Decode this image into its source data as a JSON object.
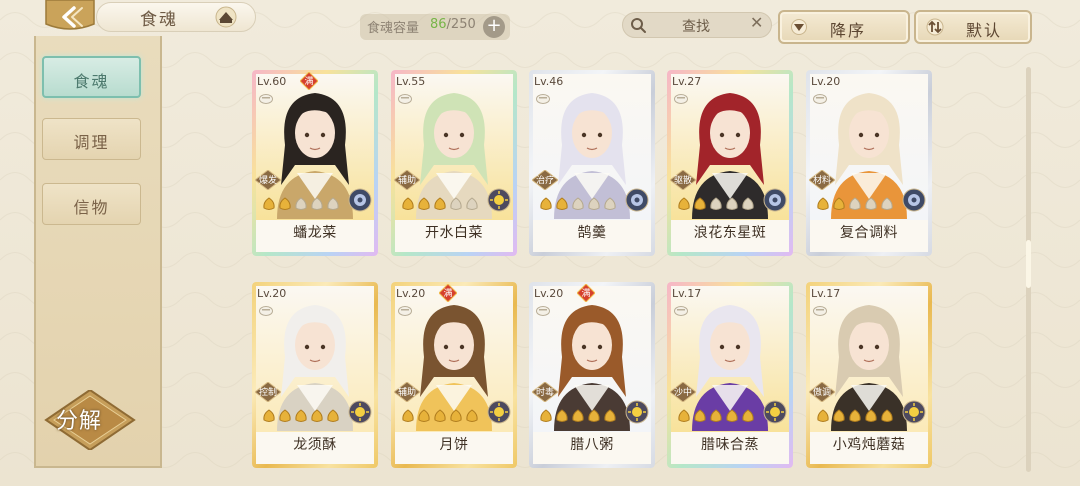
{
  "header": {
    "title": "食魂",
    "capacity_label": "食魂容量",
    "capacity_current": "86",
    "capacity_total": "/250",
    "capacity_add": "+",
    "search_label": "查找",
    "search_clear": "✕",
    "sort_desc_label": "降序",
    "sort_default_label": "默认"
  },
  "sidebar": {
    "tabs": [
      {
        "label": "食魂",
        "active": true
      },
      {
        "label": "调理",
        "active": false
      },
      {
        "label": "信物",
        "active": false
      }
    ],
    "decompose_label": "分解"
  },
  "cards": [
    {
      "level": "Lv.60",
      "name": "蟠龙菜",
      "role": "爆发",
      "max": true,
      "max_label": "满",
      "stars": 2,
      "element": "moon",
      "frame": "rainbow",
      "hair": "#2a2420",
      "accent": "#c9a76a"
    },
    {
      "level": "Lv.55",
      "name": "开水白菜",
      "role": "辅助",
      "max": false,
      "stars": 3,
      "element": "sun",
      "frame": "rainbow",
      "hair": "#cfe3b6",
      "accent": "#e6d9bf"
    },
    {
      "level": "Lv.46",
      "name": "鹄羹",
      "role": "治疗",
      "max": false,
      "stars": 2,
      "element": "moon",
      "frame": "silver",
      "hair": "#e4e2ee",
      "accent": "#c2bfd6"
    },
    {
      "level": "Lv.27",
      "name": "浪花东星斑",
      "role": "驱散",
      "max": false,
      "stars": 2,
      "element": "moon",
      "frame": "rainbow",
      "hair": "#a2242a",
      "accent": "#2e2b2b"
    },
    {
      "level": "Lv.20",
      "name": "复合调料",
      "role": "材料",
      "max": false,
      "stars": 2,
      "element": "moon",
      "frame": "silver",
      "hair": "#efe2c8",
      "accent": "#e9953a"
    },
    {
      "level": "Lv.20",
      "name": "龙须酥",
      "role": "控制",
      "max": false,
      "stars": 5,
      "element": "sun",
      "frame": "gold",
      "hair": "#f1efec",
      "accent": "#d9d2c3"
    },
    {
      "level": "Lv.20",
      "name": "月饼",
      "role": "辅助",
      "max": true,
      "max_label": "满",
      "stars": 5,
      "element": "sun",
      "frame": "gold",
      "hair": "#7a5430",
      "accent": "#f0c35a"
    },
    {
      "level": "Lv.20",
      "name": "腊八粥",
      "role": "时毒",
      "max": true,
      "max_label": "满",
      "stars": 5,
      "element": "sun",
      "frame": "silver",
      "hair": "#9a5a2a",
      "accent": "#4a3b34"
    },
    {
      "level": "Lv.17",
      "name": "腊味合蒸",
      "role": "沙中",
      "max": false,
      "stars": 5,
      "element": "sun",
      "frame": "rainbow",
      "hair": "#e9e6ef",
      "accent": "#6a3da5"
    },
    {
      "level": "Lv.17",
      "name": "小鸡炖蘑菇",
      "role": "傲调",
      "max": false,
      "stars": 5,
      "element": "sun",
      "frame": "gold",
      "hair": "#d9cbb1",
      "accent": "#3a3128"
    }
  ]
}
